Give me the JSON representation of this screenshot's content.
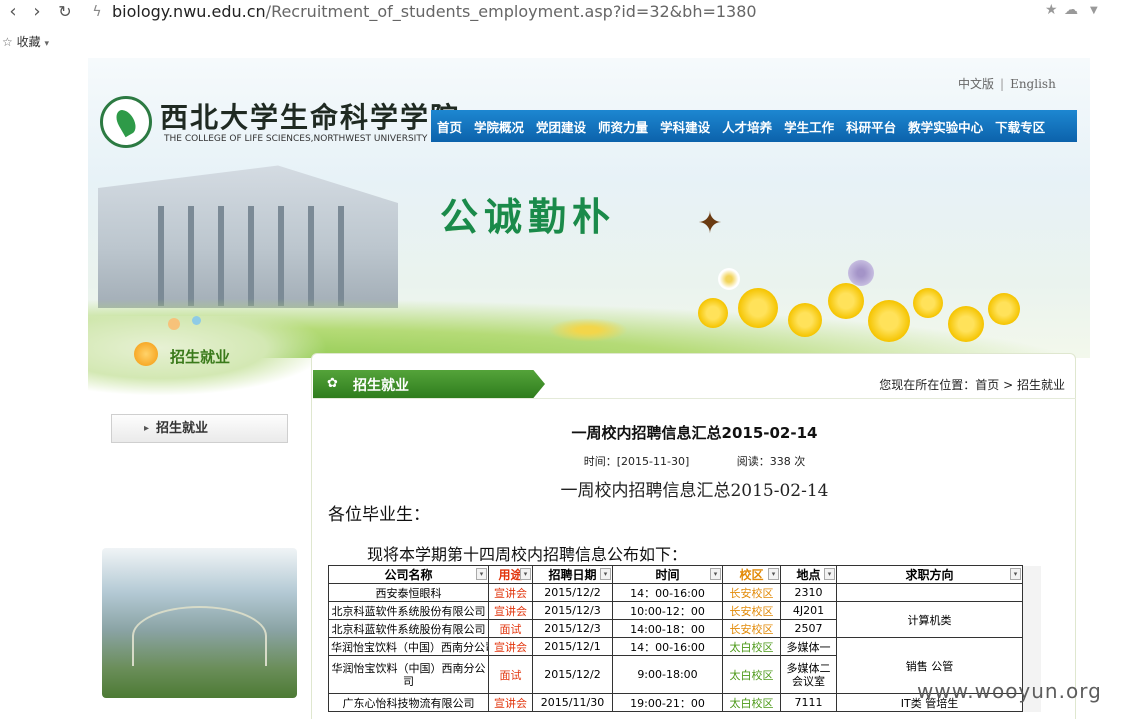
{
  "browser": {
    "url_host": "biology.nwu.edu.cn",
    "url_path": "/Recruitment_of_students_employment.asp?id=32&bh=1380",
    "bookmarks_label": "收藏",
    "bookmarks_caret": "▾"
  },
  "header": {
    "lang": {
      "cn": "中文版",
      "sep": "|",
      "en": "English"
    },
    "logo_cn": "西北大学生命科学学院",
    "logo_en": "THE COLLEGE OF LIFE SCIENCES,NORTHWEST UNIVERSITY",
    "nav": [
      "首页",
      "学院概况",
      "党团建设",
      "师资力量",
      "学科建设",
      "人才培养",
      "学生工作",
      "科研平台",
      "教学实验中心",
      "下载专区"
    ],
    "slogan": "公诚勤朴"
  },
  "sidebar": {
    "title": "招生就业",
    "items": [
      {
        "label": "招生就业"
      }
    ]
  },
  "content": {
    "tab_label": "招生就业",
    "breadcrumb": {
      "prefix": "您现在所在位置：",
      "home": "首页",
      "sep": ">",
      "current": "招生就业"
    },
    "title": "一周校内招聘信息汇总2015-02-14",
    "meta_time": "时间：[2015-11-30]",
    "meta_reads": "阅读：338 次",
    "sub_title": "一周校内招聘信息汇总2015-02-14",
    "greeting": "各位毕业生：",
    "intro": "现将本学期第十四周校内招聘信息公布如下："
  },
  "table": {
    "headers": [
      "公司名称",
      "用途",
      "招聘日期",
      "时间",
      "校区",
      "地点",
      "求职方向"
    ],
    "filter_glyph": "▾",
    "rows": [
      {
        "company": "西安泰恒眼科",
        "purpose": "宣讲会",
        "date": "2015/12/2",
        "time": "14：00-16:00",
        "campus": "长安校区",
        "place": "2310",
        "direction": ""
      },
      {
        "company": "北京科蓝软件系统股份有限公司",
        "purpose": "宣讲会",
        "date": "2015/12/3",
        "time": "10:00-12：00",
        "campus": "长安校区",
        "place": "4J201",
        "direction": "计算机类"
      },
      {
        "company": "北京科蓝软件系统股份有限公司",
        "purpose": "面试",
        "date": "2015/12/3",
        "time": "14:00-18：00",
        "campus": "长安校区",
        "place": "2507",
        "direction": ""
      },
      {
        "company": "华润怡宝饮料（中国）西南分公司",
        "purpose": "宣讲会",
        "date": "2015/12/1",
        "time": "14：00-16:00",
        "campus": "太白校区",
        "place": "多媒体一",
        "direction": "销售  公管"
      },
      {
        "company": "华润怡宝饮料（中国）西南分公司",
        "purpose": "面试",
        "date": "2015/12/2",
        "time": "9:00-18:00",
        "campus": "太白校区",
        "place": "多媒体二会议室",
        "direction": ""
      },
      {
        "company": "广东心怡科技物流有限公司",
        "purpose": "宣讲会",
        "date": "2015/11/30",
        "time": "19:00-21：00",
        "campus": "太白校区",
        "place": "7111",
        "direction": "IT类 管培生"
      }
    ]
  },
  "watermark": "www.wooyun.org",
  "colors": {
    "nav_blue": "#0c62ab",
    "tab_green": "#2f7d1d",
    "purpose_red": "#e2360e",
    "campus_changan": "#e28a07",
    "campus_taibai": "#4e9a1a"
  }
}
